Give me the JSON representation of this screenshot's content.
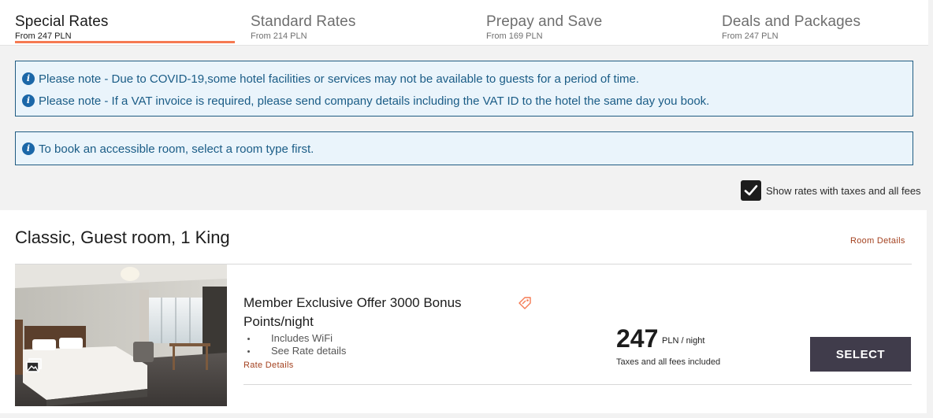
{
  "rate_tabs": [
    {
      "label": "Special Rates",
      "sub": "From 247 PLN",
      "active": true
    },
    {
      "label": "Standard Rates",
      "sub": "From 214 PLN",
      "active": false
    },
    {
      "label": "Prepay and Save",
      "sub": "From 169 PLN",
      "active": false
    },
    {
      "label": "Deals and Packages",
      "sub": "From 247 PLN",
      "active": false
    }
  ],
  "notices": {
    "covid": "Please note - Due to COVID-19,some hotel facilities or services may not be available to guests for a period of time.",
    "vat": "Please note - If a VAT invoice is required, please send company details including the VAT ID to the hotel the same day you book.",
    "accessible": "To book an accessible room, select a room type first."
  },
  "tax_toggle": {
    "label": "Show rates with taxes and all fees",
    "checked": true
  },
  "room": {
    "title": "Classic, Guest room, 1 King",
    "details_link": "Room Details",
    "offer": {
      "title": "Member Exclusive Offer 3000 Bonus Points/night",
      "amenities": [
        "Includes WiFi",
        "See Rate details"
      ],
      "rate_details_link": "Rate Details",
      "price": "247",
      "price_unit": "PLN / night",
      "price_note": "Taxes and all fees included",
      "select_label": "SELECT"
    }
  },
  "colors": {
    "accent_tab": "#f57a52",
    "link": "#a3411f",
    "notice_bg": "#eaf4fb",
    "notice_text": "#1a5c86",
    "select_bg": "#403c4b"
  },
  "icons": {
    "info": "info-icon",
    "checkbox": "check-icon",
    "gallery": "photo-gallery-icon",
    "offer_tag": "tag-icon"
  }
}
